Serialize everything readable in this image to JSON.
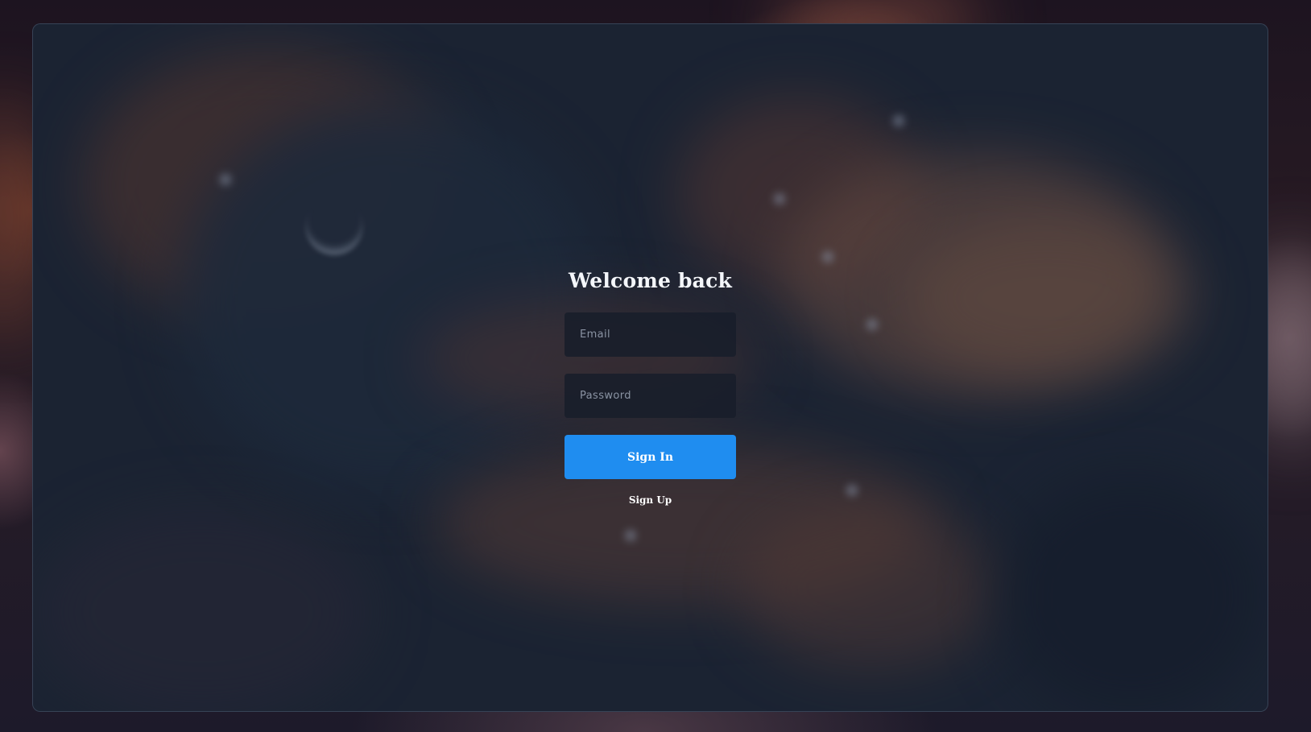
{
  "login": {
    "title": "Welcome back",
    "email_placeholder": "Email",
    "password_placeholder": "Password",
    "sign_in_label": "Sign In",
    "sign_up_label": "Sign Up"
  },
  "colors": {
    "accent": "#1f8df0",
    "panel": "#1f2737",
    "field": "#181e2a",
    "title": "#f4f6fa"
  }
}
